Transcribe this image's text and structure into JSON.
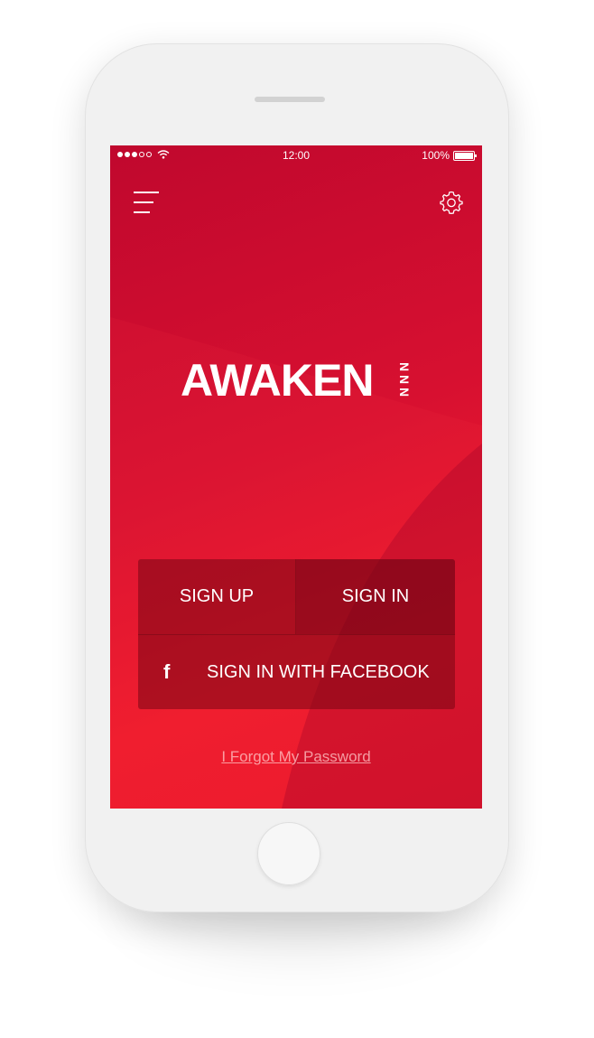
{
  "status_bar": {
    "time": "12:00",
    "battery_percent": "100%",
    "signal_dots_filled": 3,
    "signal_dots_total": 5,
    "wifi_icon": "wifi-icon",
    "battery_icon": "battery-icon"
  },
  "header": {
    "menu_icon": "hamburger-menu-icon",
    "settings_icon": "gear-icon"
  },
  "logo": {
    "text": "AWAKEN",
    "mark": "NNN"
  },
  "auth": {
    "sign_up_label": "SIGN UP",
    "sign_in_label": "SIGN IN",
    "facebook_label": "SIGN IN WITH FACEBOOK",
    "facebook_icon": "facebook-icon"
  },
  "forgot_password_label": "I Forgot My Password",
  "colors": {
    "screen_top": "#c0082e",
    "screen_bottom": "#ef1b2d",
    "panel": "#8e0c1e",
    "text": "#ffffff",
    "device_frame": "#f1f1f1"
  }
}
